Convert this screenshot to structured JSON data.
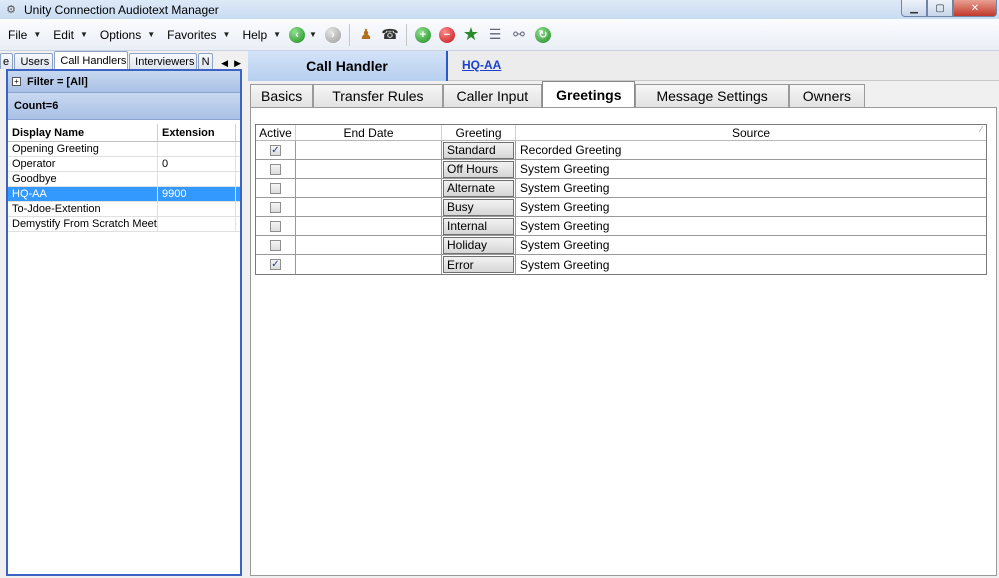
{
  "window": {
    "title": "Unity Connection Audiotext Manager"
  },
  "menu": [
    "File",
    "Edit",
    "Options",
    "Favorites",
    "Help"
  ],
  "left": {
    "tabs": [
      "e",
      "Users",
      "Call Handlers",
      "Interviewers",
      "N"
    ],
    "filter": "Filter = [All]",
    "count": "Count=6",
    "columns": [
      "Display Name",
      "Extension"
    ],
    "rows": [
      {
        "name": "Opening Greeting",
        "ext": ""
      },
      {
        "name": "Operator",
        "ext": "0"
      },
      {
        "name": "Goodbye",
        "ext": ""
      },
      {
        "name": "HQ-AA",
        "ext": "9900"
      },
      {
        "name": "To-Jdoe-Extention",
        "ext": ""
      },
      {
        "name": "Demystify From Scratch Meeting",
        "ext": ""
      }
    ]
  },
  "right": {
    "section_title": "Call Handler",
    "handler_link": "HQ-AA",
    "tabs": [
      "Basics",
      "Transfer Rules",
      "Caller Input",
      "Greetings",
      "Message Settings",
      "Owners"
    ],
    "grid_columns": [
      "Active",
      "End Date",
      "Greeting",
      "Source"
    ],
    "greetings": [
      {
        "active": true,
        "end_date": "",
        "greeting": "Standard",
        "source": "Recorded Greeting"
      },
      {
        "active": false,
        "end_date": "",
        "greeting": "Off Hours",
        "source": "System Greeting"
      },
      {
        "active": false,
        "end_date": "",
        "greeting": "Alternate",
        "source": "System Greeting"
      },
      {
        "active": false,
        "end_date": "",
        "greeting": "Busy",
        "source": "System Greeting"
      },
      {
        "active": false,
        "end_date": "",
        "greeting": "Internal",
        "source": "System Greeting"
      },
      {
        "active": false,
        "end_date": "",
        "greeting": "Holiday",
        "source": "System Greeting"
      },
      {
        "active": true,
        "end_date": "",
        "greeting": "Error",
        "source": "System Greeting"
      }
    ]
  }
}
